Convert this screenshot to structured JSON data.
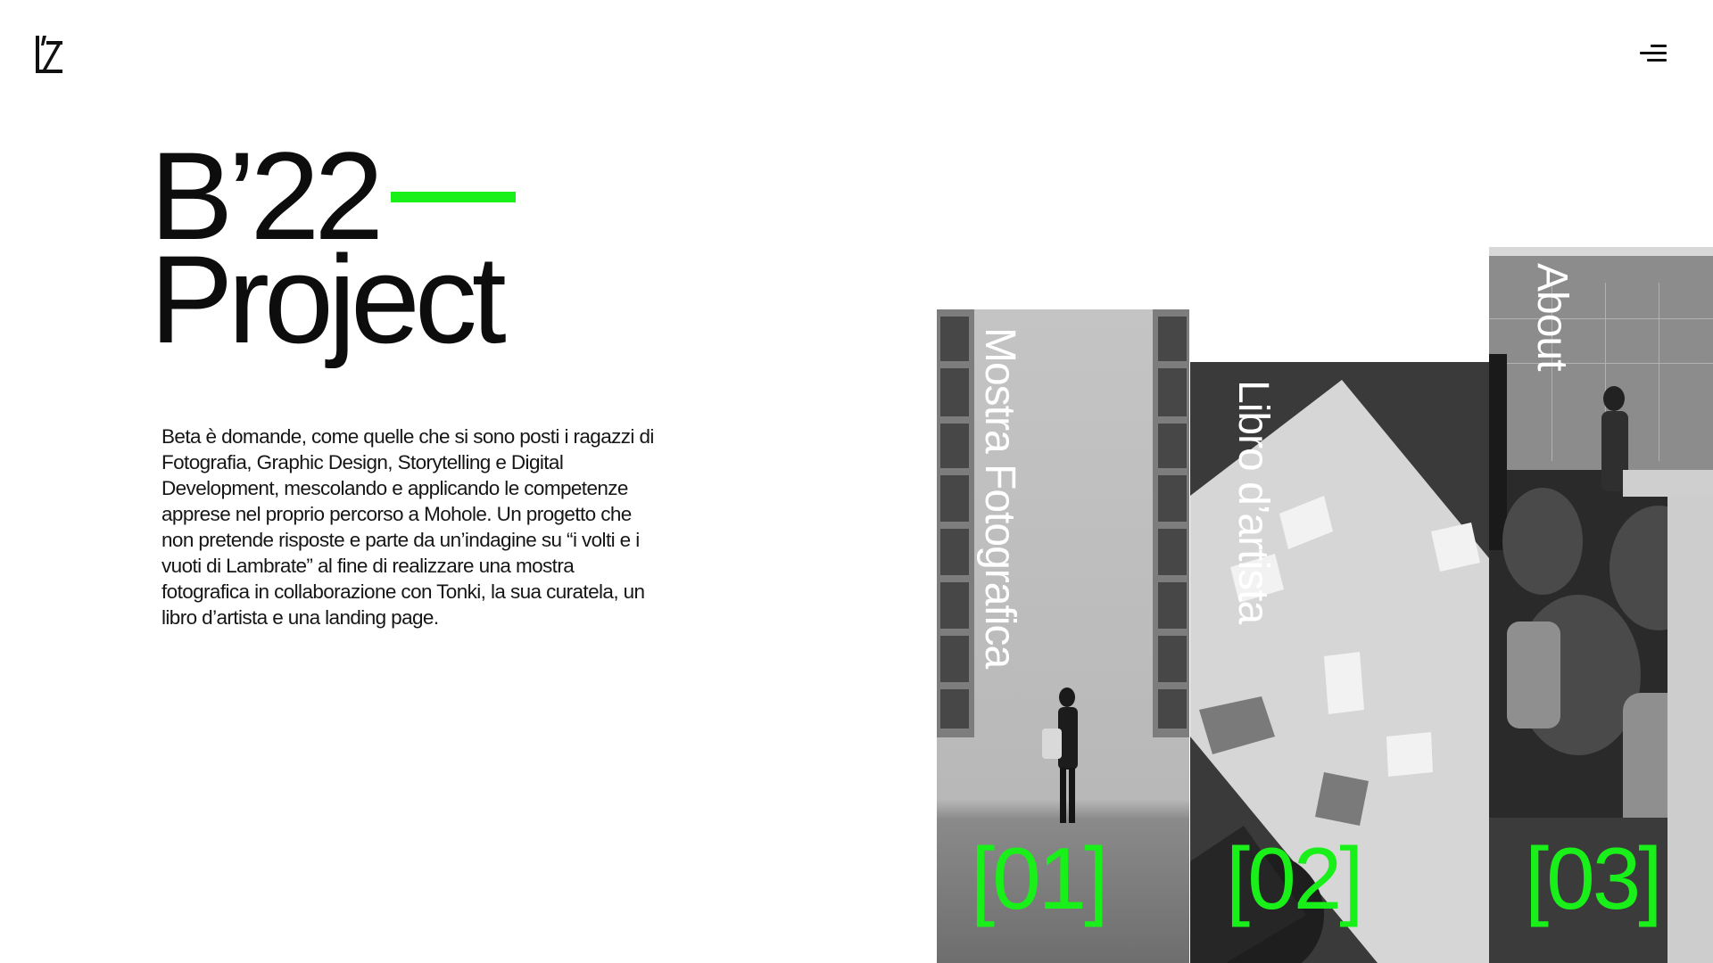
{
  "header": {
    "logo_icon": "lz-monogram-logo",
    "menu_icon": "hamburger-menu-icon"
  },
  "hero": {
    "line1": "B’22",
    "line2": "Project",
    "accent_color": "#19f01a"
  },
  "description": "Beta è domande, come quelle che si sono posti i ragazzi di Fotografia, Graphic Design, Storytelling e Digital Development, mescolando e applicando le competenze apprese nel proprio percorso a Mohole. Un progetto che non pretende risposte e parte da un’indagine su “i volti e i vuoti di Lambrate” al fine di realizzare una mostra fotografica in collaborazione con Tonki, la sua curatela, un libro d’artista e una landing page.",
  "cards": [
    {
      "title": "Mostra Fotografica",
      "number": "[01]"
    },
    {
      "title": "Libro d’artista",
      "number": "[02]"
    },
    {
      "title": "About",
      "number": "[03]"
    }
  ]
}
